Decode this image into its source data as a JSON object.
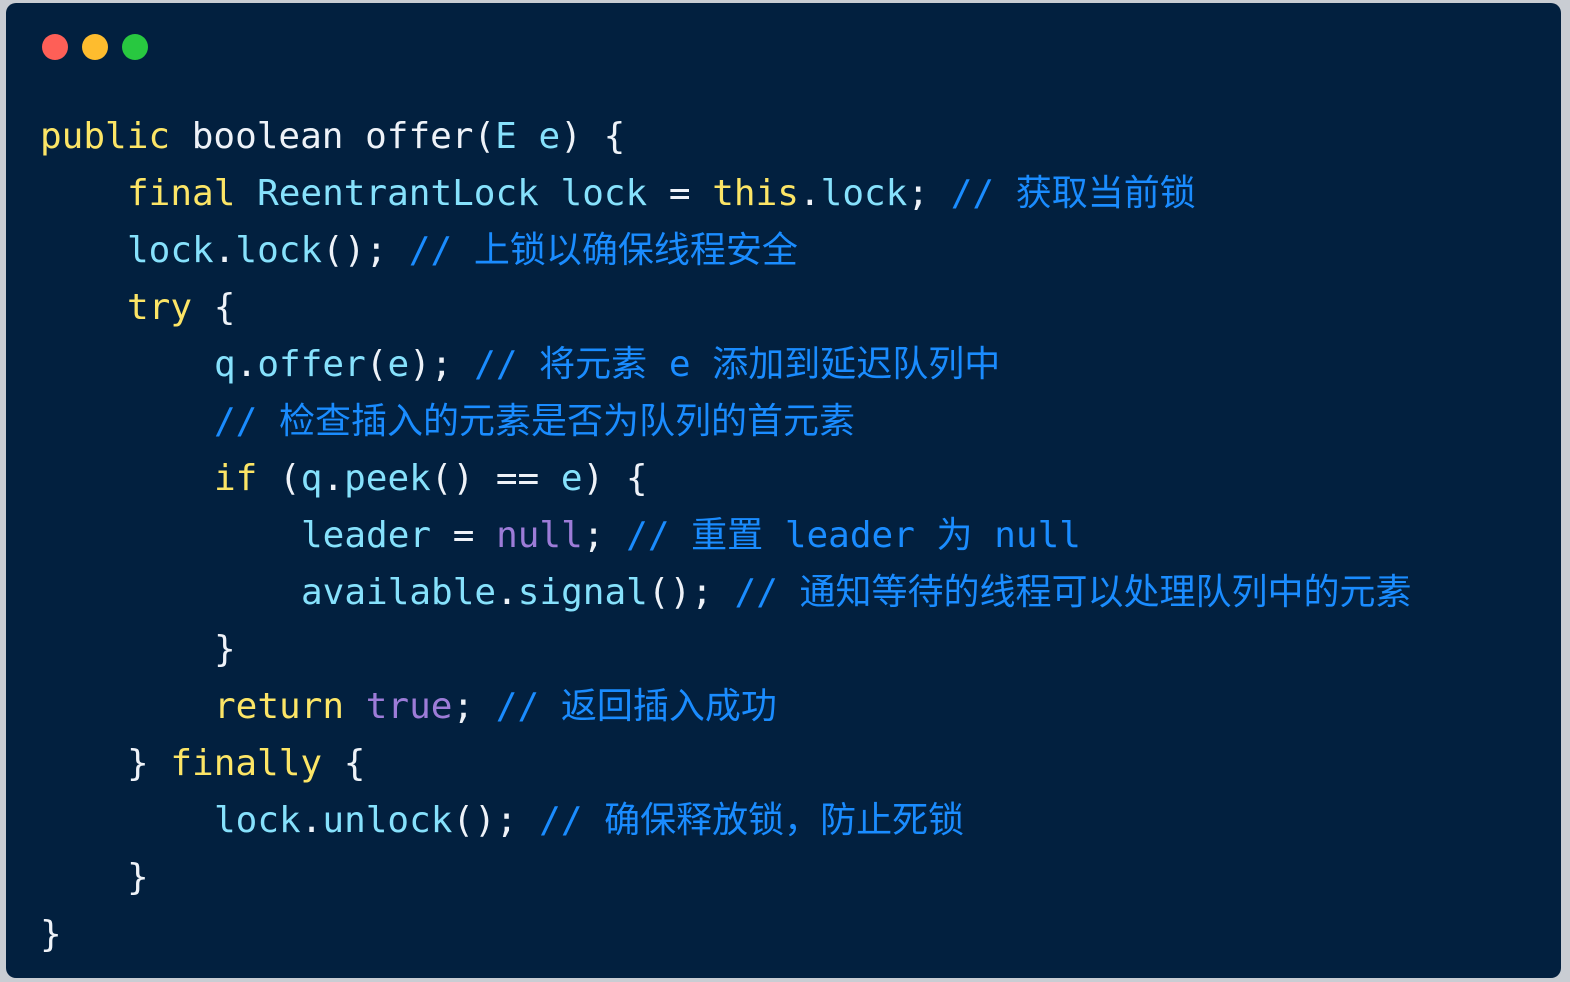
{
  "window": {
    "controls": [
      "close",
      "minimize",
      "maximize"
    ],
    "colors": {
      "background": "#02203f",
      "close": "#fe5f57",
      "minimize": "#febc2e",
      "maximize": "#28c840"
    }
  },
  "code": {
    "language": "java",
    "lines": [
      {
        "indent": 0,
        "tokens": [
          {
            "t": "kw",
            "v": "public"
          },
          {
            "t": "pl",
            "v": " boolean offer("
          },
          {
            "t": "ty",
            "v": "E"
          },
          {
            "t": "pl",
            "v": " "
          },
          {
            "t": "ty",
            "v": "e"
          },
          {
            "t": "pl",
            "v": ") {"
          }
        ]
      },
      {
        "indent": 1,
        "tokens": [
          {
            "t": "kw",
            "v": "final"
          },
          {
            "t": "pl",
            "v": " "
          },
          {
            "t": "ty",
            "v": "ReentrantLock"
          },
          {
            "t": "pl",
            "v": " "
          },
          {
            "t": "ty",
            "v": "lock"
          },
          {
            "t": "pl",
            "v": " = "
          },
          {
            "t": "kw",
            "v": "this"
          },
          {
            "t": "pl",
            "v": "."
          },
          {
            "t": "ty",
            "v": "lock"
          },
          {
            "t": "pl",
            "v": "; "
          },
          {
            "t": "cm",
            "v": "// 获取当前锁"
          }
        ]
      },
      {
        "indent": 1,
        "tokens": [
          {
            "t": "ty",
            "v": "lock"
          },
          {
            "t": "pl",
            "v": "."
          },
          {
            "t": "ty",
            "v": "lock"
          },
          {
            "t": "pl",
            "v": "(); "
          },
          {
            "t": "cm",
            "v": "// 上锁以确保线程安全"
          }
        ]
      },
      {
        "indent": 1,
        "tokens": [
          {
            "t": "kw",
            "v": "try"
          },
          {
            "t": "pl",
            "v": " {"
          }
        ]
      },
      {
        "indent": 2,
        "tokens": [
          {
            "t": "ty",
            "v": "q"
          },
          {
            "t": "pl",
            "v": "."
          },
          {
            "t": "ty",
            "v": "offer"
          },
          {
            "t": "pl",
            "v": "("
          },
          {
            "t": "ty",
            "v": "e"
          },
          {
            "t": "pl",
            "v": "); "
          },
          {
            "t": "cm",
            "v": "// 将元素 e 添加到延迟队列中"
          }
        ]
      },
      {
        "indent": 2,
        "tokens": [
          {
            "t": "cm",
            "v": "// 检查插入的元素是否为队列的首元素"
          }
        ]
      },
      {
        "indent": 2,
        "tokens": [
          {
            "t": "kw",
            "v": "if"
          },
          {
            "t": "pl",
            "v": " ("
          },
          {
            "t": "ty",
            "v": "q"
          },
          {
            "t": "pl",
            "v": "."
          },
          {
            "t": "ty",
            "v": "peek"
          },
          {
            "t": "pl",
            "v": "() == "
          },
          {
            "t": "ty",
            "v": "e"
          },
          {
            "t": "pl",
            "v": ") {"
          }
        ]
      },
      {
        "indent": 3,
        "tokens": [
          {
            "t": "ty",
            "v": "leader"
          },
          {
            "t": "pl",
            "v": " = "
          },
          {
            "t": "lit",
            "v": "null"
          },
          {
            "t": "pl",
            "v": "; "
          },
          {
            "t": "cm",
            "v": "// 重置 leader 为 null"
          }
        ]
      },
      {
        "indent": 3,
        "tokens": [
          {
            "t": "ty",
            "v": "available"
          },
          {
            "t": "pl",
            "v": "."
          },
          {
            "t": "ty",
            "v": "signal"
          },
          {
            "t": "pl",
            "v": "(); "
          },
          {
            "t": "cm",
            "v": "// 通知等待的线程可以处理队列中的元素"
          }
        ]
      },
      {
        "indent": 2,
        "tokens": [
          {
            "t": "pl",
            "v": "}"
          }
        ]
      },
      {
        "indent": 2,
        "tokens": [
          {
            "t": "kw",
            "v": "return"
          },
          {
            "t": "pl",
            "v": " "
          },
          {
            "t": "lit",
            "v": "true"
          },
          {
            "t": "pl",
            "v": "; "
          },
          {
            "t": "cm",
            "v": "// 返回插入成功"
          }
        ]
      },
      {
        "indent": 1,
        "tokens": [
          {
            "t": "pl",
            "v": "} "
          },
          {
            "t": "kw",
            "v": "finally"
          },
          {
            "t": "pl",
            "v": " {"
          }
        ]
      },
      {
        "indent": 2,
        "tokens": [
          {
            "t": "ty",
            "v": "lock"
          },
          {
            "t": "pl",
            "v": "."
          },
          {
            "t": "ty",
            "v": "unlock"
          },
          {
            "t": "pl",
            "v": "(); "
          },
          {
            "t": "cm",
            "v": "// 确保释放锁，防止死锁"
          }
        ]
      },
      {
        "indent": 1,
        "tokens": [
          {
            "t": "pl",
            "v": "}"
          }
        ]
      },
      {
        "indent": 0,
        "tokens": [
          {
            "t": "pl",
            "v": "}"
          }
        ]
      }
    ]
  }
}
